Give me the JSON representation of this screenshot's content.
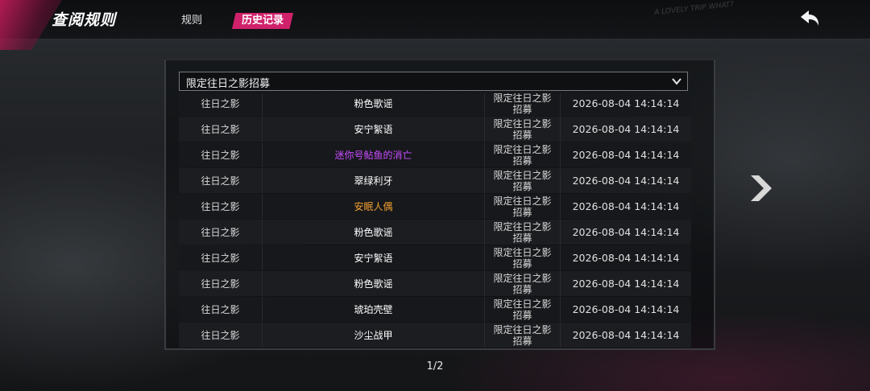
{
  "header": {
    "title": "查阅规则",
    "tabs": [
      {
        "label": "规则"
      },
      {
        "label": "历史记录"
      }
    ],
    "deco_text": "A LOVELY TRIP WHAT?"
  },
  "filter": {
    "selected": "限定往日之影招募"
  },
  "table": {
    "rows": [
      {
        "type": "往日之影",
        "item": "粉色歌谣",
        "item_color": "#ffffff",
        "pool_l1": "限定往日之影",
        "pool_l2": "招募",
        "time": "2026-08-04 14:14:14"
      },
      {
        "type": "往日之影",
        "item": "安宁絮语",
        "item_color": "#ffffff",
        "pool_l1": "限定往日之影",
        "pool_l2": "招募",
        "time": "2026-08-04 14:14:14"
      },
      {
        "type": "往日之影",
        "item": "迷你号鲇鱼的消亡",
        "item_color": "#c84cff",
        "pool_l1": "限定往日之影",
        "pool_l2": "招募",
        "time": "2026-08-04 14:14:14"
      },
      {
        "type": "往日之影",
        "item": "翠绿利牙",
        "item_color": "#ffffff",
        "pool_l1": "限定往日之影",
        "pool_l2": "招募",
        "time": "2026-08-04 14:14:14"
      },
      {
        "type": "往日之影",
        "item": "安眠人偶",
        "item_color": "#f0a030",
        "pool_l1": "限定往日之影",
        "pool_l2": "招募",
        "time": "2026-08-04 14:14:14"
      },
      {
        "type": "往日之影",
        "item": "粉色歌谣",
        "item_color": "#ffffff",
        "pool_l1": "限定往日之影",
        "pool_l2": "招募",
        "time": "2026-08-04 14:14:14"
      },
      {
        "type": "往日之影",
        "item": "安宁絮语",
        "item_color": "#ffffff",
        "pool_l1": "限定往日之影",
        "pool_l2": "招募",
        "time": "2026-08-04 14:14:14"
      },
      {
        "type": "往日之影",
        "item": "粉色歌谣",
        "item_color": "#ffffff",
        "pool_l1": "限定往日之影",
        "pool_l2": "招募",
        "time": "2026-08-04 14:14:14"
      },
      {
        "type": "往日之影",
        "item": "琥珀壳壁",
        "item_color": "#ffffff",
        "pool_l1": "限定往日之影",
        "pool_l2": "招募",
        "time": "2026-08-04 14:14:14"
      },
      {
        "type": "往日之影",
        "item": "沙尘战甲",
        "item_color": "#ffffff",
        "pool_l1": "限定往日之影",
        "pool_l2": "招募",
        "time": "2026-08-04 14:14:14"
      }
    ]
  },
  "pagination": {
    "label": "1/2"
  },
  "icons": {
    "back": "back-arrow-icon",
    "next": "chevron-right-icon",
    "dropdown": "chevron-down-icon"
  },
  "colors": {
    "accent": "#d0216b",
    "rare_purple": "#c84cff",
    "rare_gold": "#f0a030"
  }
}
